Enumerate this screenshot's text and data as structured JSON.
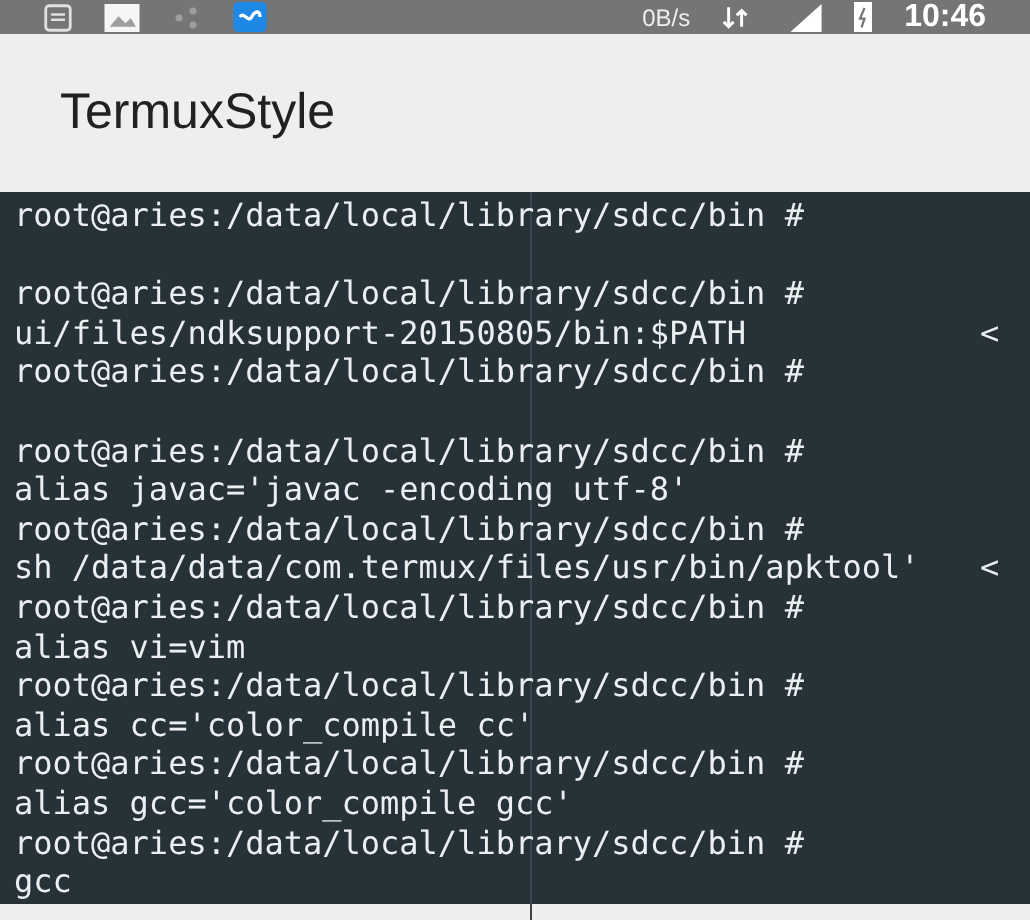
{
  "status_bar": {
    "speed": "0B/s",
    "time": "10:46"
  },
  "app_bar": {
    "title": "TermuxStyle"
  },
  "terminal": {
    "lines": [
      {
        "kind": "text",
        "text": "root@aries:/data/local/library/sdcc/bin #"
      },
      {
        "kind": "blank"
      },
      {
        "kind": "text",
        "text": "root@aries:/data/local/library/sdcc/bin #"
      },
      {
        "kind": "text",
        "text": "ui/files/ndksupport-20150805/bin:$PATH",
        "overflow_mark": "<"
      },
      {
        "kind": "text",
        "text": "root@aries:/data/local/library/sdcc/bin #"
      },
      {
        "kind": "blank"
      },
      {
        "kind": "text",
        "text": "root@aries:/data/local/library/sdcc/bin #"
      },
      {
        "kind": "text",
        "text": "alias javac='javac -encoding utf-8'"
      },
      {
        "kind": "text",
        "text": "root@aries:/data/local/library/sdcc/bin #"
      },
      {
        "kind": "text",
        "text": "sh /data/data/com.termux/files/usr/bin/apktool'",
        "overflow_mark": "<"
      },
      {
        "kind": "text",
        "text": "root@aries:/data/local/library/sdcc/bin #"
      },
      {
        "kind": "text",
        "text": "alias vi=vim"
      },
      {
        "kind": "text",
        "text": "root@aries:/data/local/library/sdcc/bin #"
      },
      {
        "kind": "text",
        "text": "alias cc='color_compile cc'"
      },
      {
        "kind": "text",
        "text": "root@aries:/data/local/library/sdcc/bin #"
      },
      {
        "kind": "text",
        "text": "alias gcc='color_compile gcc'"
      },
      {
        "kind": "text",
        "text": "root@aries:/data/local/library/sdcc/bin #"
      },
      {
        "kind": "text",
        "text": "gcc"
      }
    ]
  }
}
